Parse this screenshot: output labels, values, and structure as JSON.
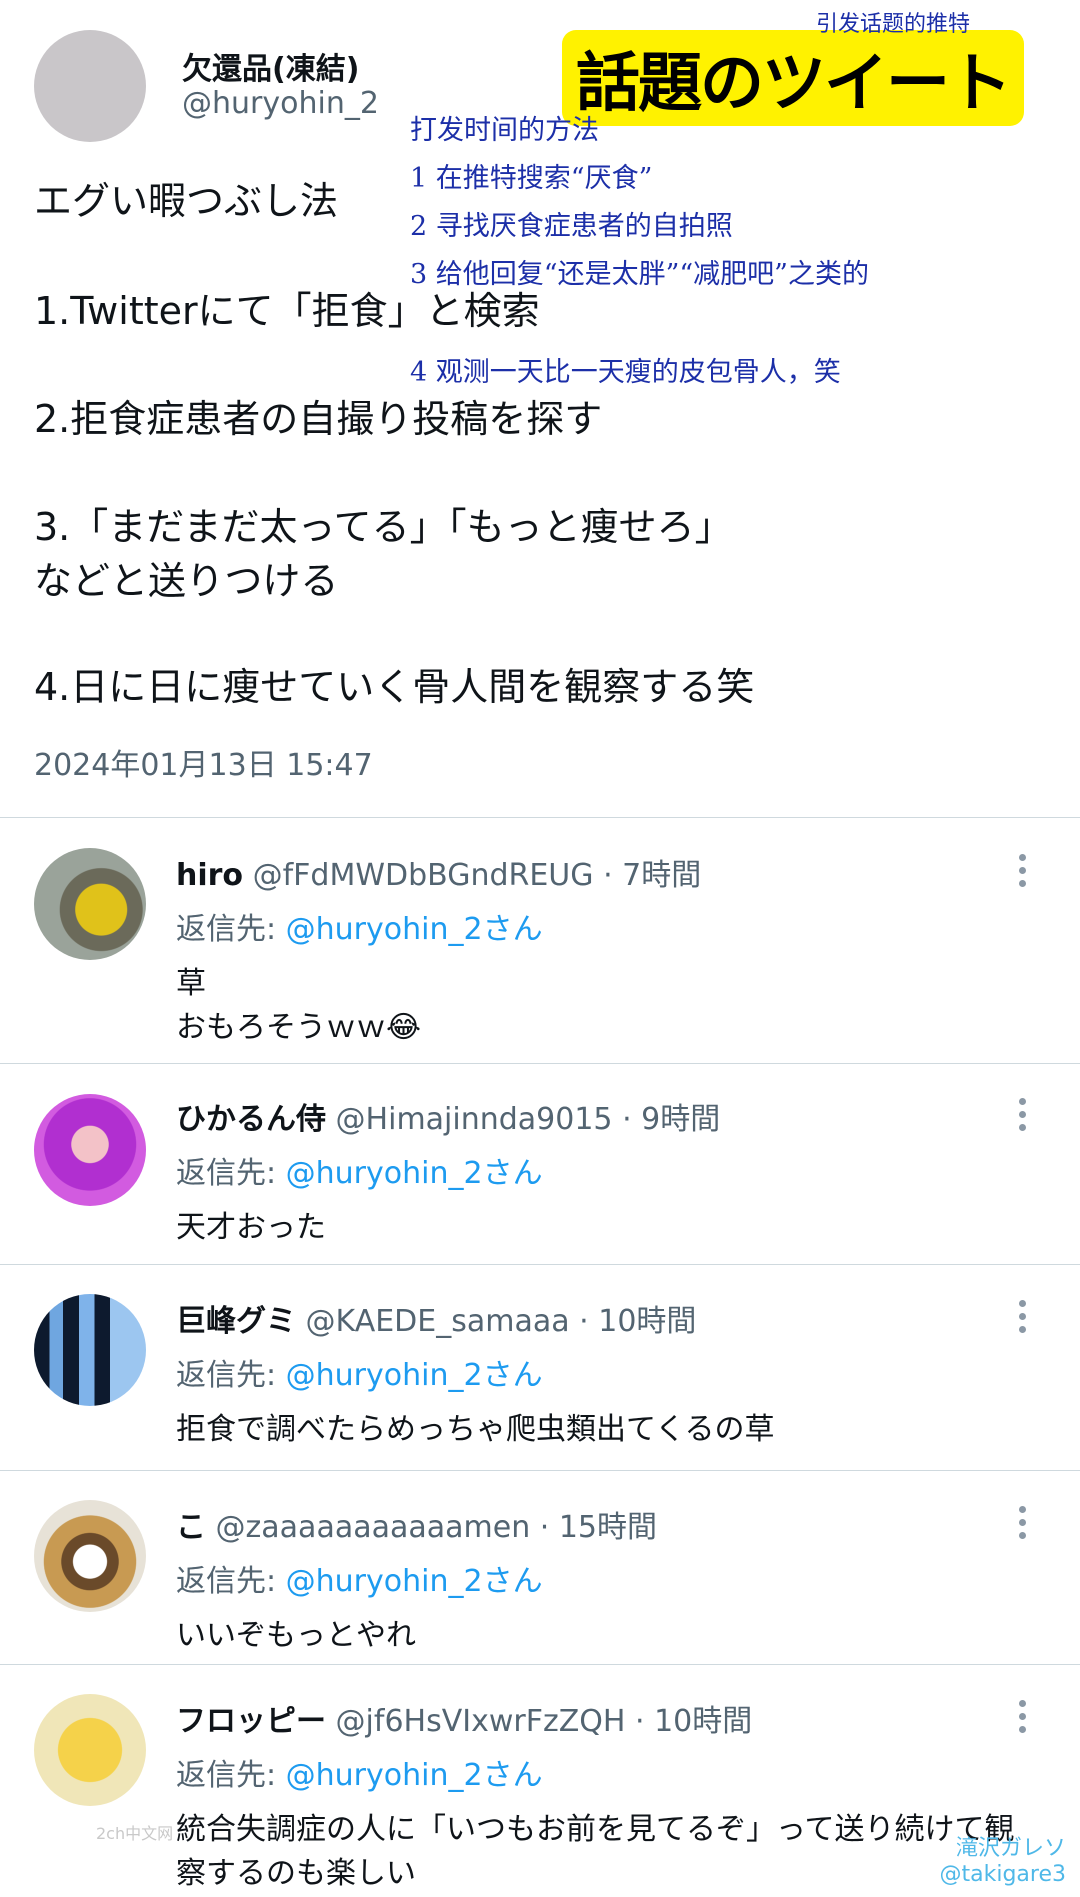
{
  "tweet": {
    "author_name": "欠還品(凍結)",
    "author_handle": "@huryohin_2",
    "lines": [
      "エグい暇つぶし法",
      "1.Twitterにて「拒食」と検索",
      "2.拒食症患者の自撮り投稿を探す",
      "3.「まだまだ太ってる」「もっと痩せろ」",
      "などと送りつける",
      "4.日に日に痩せていく骨人間を観察する笑"
    ],
    "timestamp": "2024年01月13日 15:47"
  },
  "overlay": {
    "banner": "話題のツイート",
    "banner_note": "引发话题的推特",
    "translation": [
      "打发时间的方法",
      "1 在推特搜索“厌食”",
      "2 寻找厌食症患者的自拍照",
      "3 给他回复“还是太胖”“减肥吧”之类的",
      "4 观测一天比一天瘦的皮包骨人，笑"
    ]
  },
  "replies": [
    {
      "name": "hiro",
      "handle": "@fFdMWDbBGndREUG",
      "time": "· 7時間",
      "reply_label": "返信先:",
      "reply_to": "@huryohin_2さん",
      "text": [
        "草",
        "おもろそうｗｗ😂"
      ],
      "avatar_icon": "car-photo-avatar"
    },
    {
      "name": "ひかるん侍",
      "handle": "@Himajinnda9015",
      "time": "· 9時間",
      "reply_label": "返信先:",
      "reply_to": "@huryohin_2さん",
      "text": [
        "天才おった"
      ],
      "avatar_icon": "person-photo-avatar"
    },
    {
      "name": "巨峰グミ",
      "handle": "@KAEDE_samaaa",
      "time": "· 10時間",
      "reply_label": "返信先:",
      "reply_to": "@huryohin_2さん",
      "text": [
        "拒食で調べたらめっちゃ爬虫類出てくるの草"
      ],
      "avatar_icon": "window-sky-avatar"
    },
    {
      "name": "こ",
      "handle": "@zaaaaaaaaaaamen",
      "time": "· 15時間",
      "reply_label": "返信先:",
      "reply_to": "@huryohin_2さん",
      "text": [
        "いいぞもっとやれ"
      ],
      "avatar_icon": "cartoon-character-avatar"
    },
    {
      "name": "フロッピー",
      "handle": "@jf6HsVIxwrFzZQH",
      "time": "· 10時間",
      "reply_label": "返信先:",
      "reply_to": "@huryohin_2さん",
      "text": [
        "統合失調症の人に「いつもお前を見てるぞ」って送り続けて観",
        "察するのも楽しい"
      ],
      "avatar_icon": "psyduck-avatar"
    }
  ],
  "watermark": {
    "left": "2ch中文网",
    "right_name": "滝沢ガレソ",
    "right_handle": "@takigare3"
  },
  "colors": {
    "mention": "#1d9bf0",
    "secondary_text": "#536471",
    "banner_bg": "#fff200",
    "translation_text": "#1c2fa8"
  }
}
